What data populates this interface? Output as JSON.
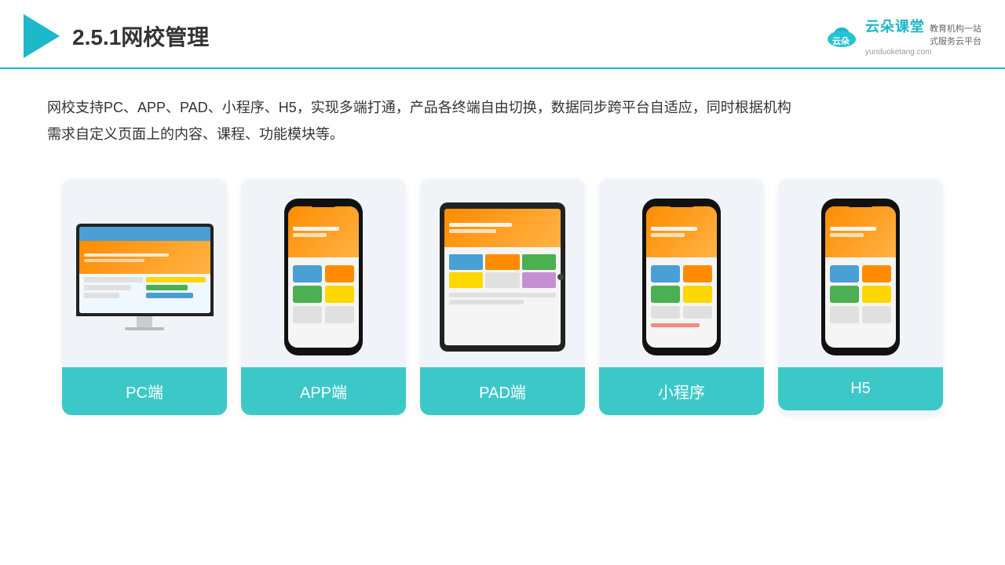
{
  "header": {
    "title_prefix": "2.5.1",
    "title_main": "网校管理",
    "brand": {
      "name": "云朵课堂",
      "url": "yunduoketang.com",
      "slogan_line1": "教育机构一站",
      "slogan_line2": "式服务云平台"
    }
  },
  "description": {
    "text": "网校支持PC、APP、PAD、小程序、H5，实现多端打通，产品各终端自由切换，数据同步跨平台自适应，同时根据机构",
    "text2": "需求自定义页面上的内容、课程、功能模块等。"
  },
  "cards": [
    {
      "id": "pc",
      "label": "PC端"
    },
    {
      "id": "app",
      "label": "APP端"
    },
    {
      "id": "pad",
      "label": "PAD端"
    },
    {
      "id": "miniprogram",
      "label": "小程序"
    },
    {
      "id": "h5",
      "label": "H5"
    }
  ]
}
